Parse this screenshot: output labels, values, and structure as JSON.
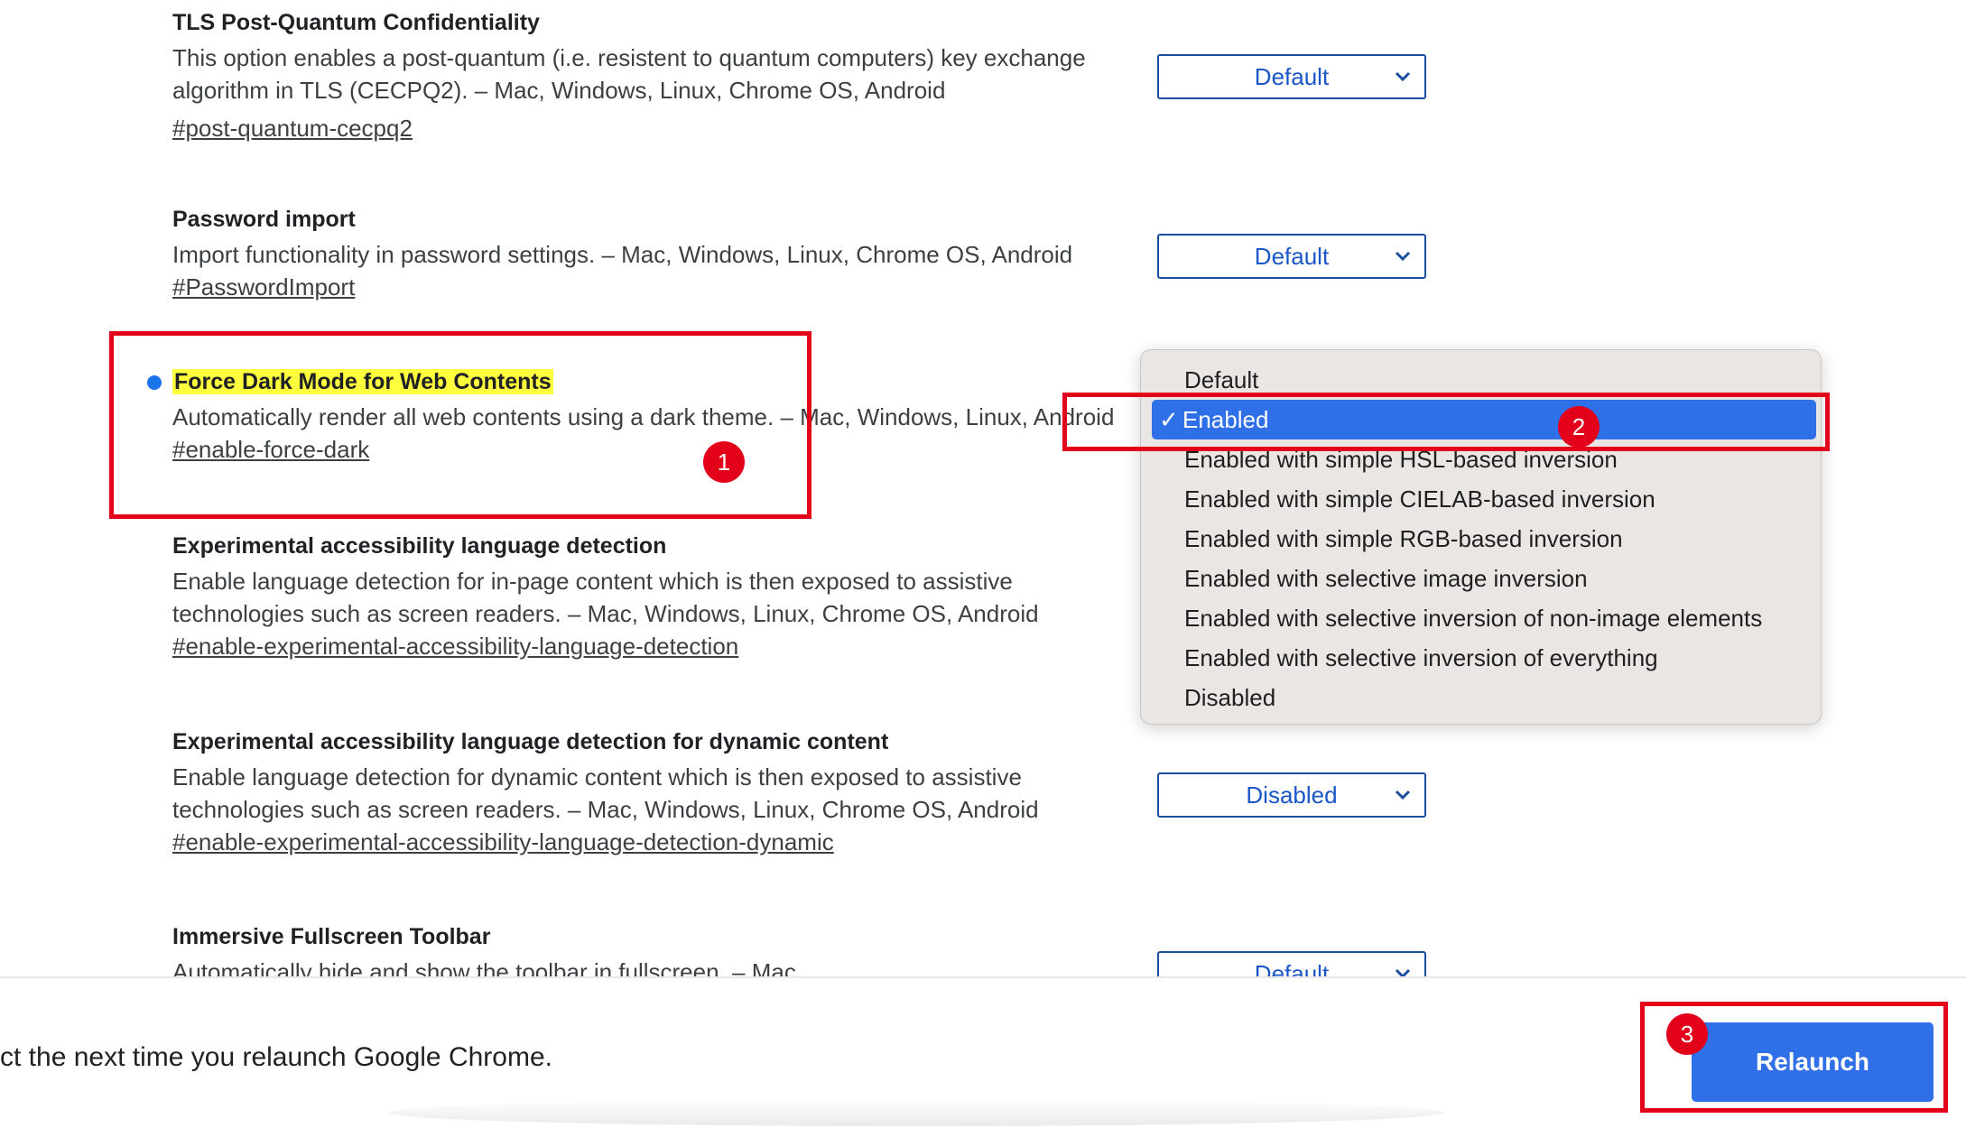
{
  "flags": [
    {
      "title": "TLS Post-Quantum Confidentiality",
      "desc1": "This option enables a post-quantum (i.e. resistent to quantum computers) key exchange",
      "desc2": "algorithm in TLS (CECPQ2). – Mac, Windows, Linux, Chrome OS, Android",
      "link": "#post-quantum-cecpq2",
      "value": "Default"
    },
    {
      "title": "Password import",
      "desc1": "Import functionality in password settings. – Mac, Windows, Linux, Chrome OS, Android",
      "link": "#PasswordImport",
      "value": "Default"
    },
    {
      "title": "Force Dark Mode for Web Contents",
      "desc1": "Automatically render all web contents using a dark theme. – Mac, Windows, Linux, Android",
      "link": "#enable-force-dark"
    },
    {
      "title": "Experimental accessibility language detection",
      "desc1": "Enable language detection for in-page content which is then exposed to assistive",
      "desc2": "technologies such as screen readers. – Mac, Windows, Linux, Chrome OS, Android",
      "link": "#enable-experimental-accessibility-language-detection"
    },
    {
      "title": "Experimental accessibility language detection for dynamic content",
      "desc1": "Enable language detection for dynamic content which is then exposed to assistive",
      "desc2": "technologies such as screen readers. – Mac, Windows, Linux, Chrome OS, Android",
      "link": "#enable-experimental-accessibility-language-detection-dynamic",
      "value": "Disabled"
    },
    {
      "title": "Immersive Fullscreen Toolbar",
      "desc1": "Automatically hide and show the toolbar in fullscreen. – Mac",
      "value": "Default"
    }
  ],
  "dropdown": {
    "options": [
      "Default",
      "Enabled",
      "Enabled with simple HSL-based inversion",
      "Enabled with simple CIELAB-based inversion",
      "Enabled with simple RGB-based inversion",
      "Enabled with selective image inversion",
      "Enabled with selective inversion of non-image elements",
      "Enabled with selective inversion of everything",
      "Disabled"
    ],
    "checkmark": "✓"
  },
  "badges": [
    "1",
    "2",
    "3"
  ],
  "bottom": {
    "message": "ct the next time you relaunch Google Chrome.",
    "relaunch_label": "Relaunch"
  },
  "colors": {
    "accent": "#2f6fe8",
    "annotation": "#e3001b",
    "highlight": "#ffff3d"
  }
}
